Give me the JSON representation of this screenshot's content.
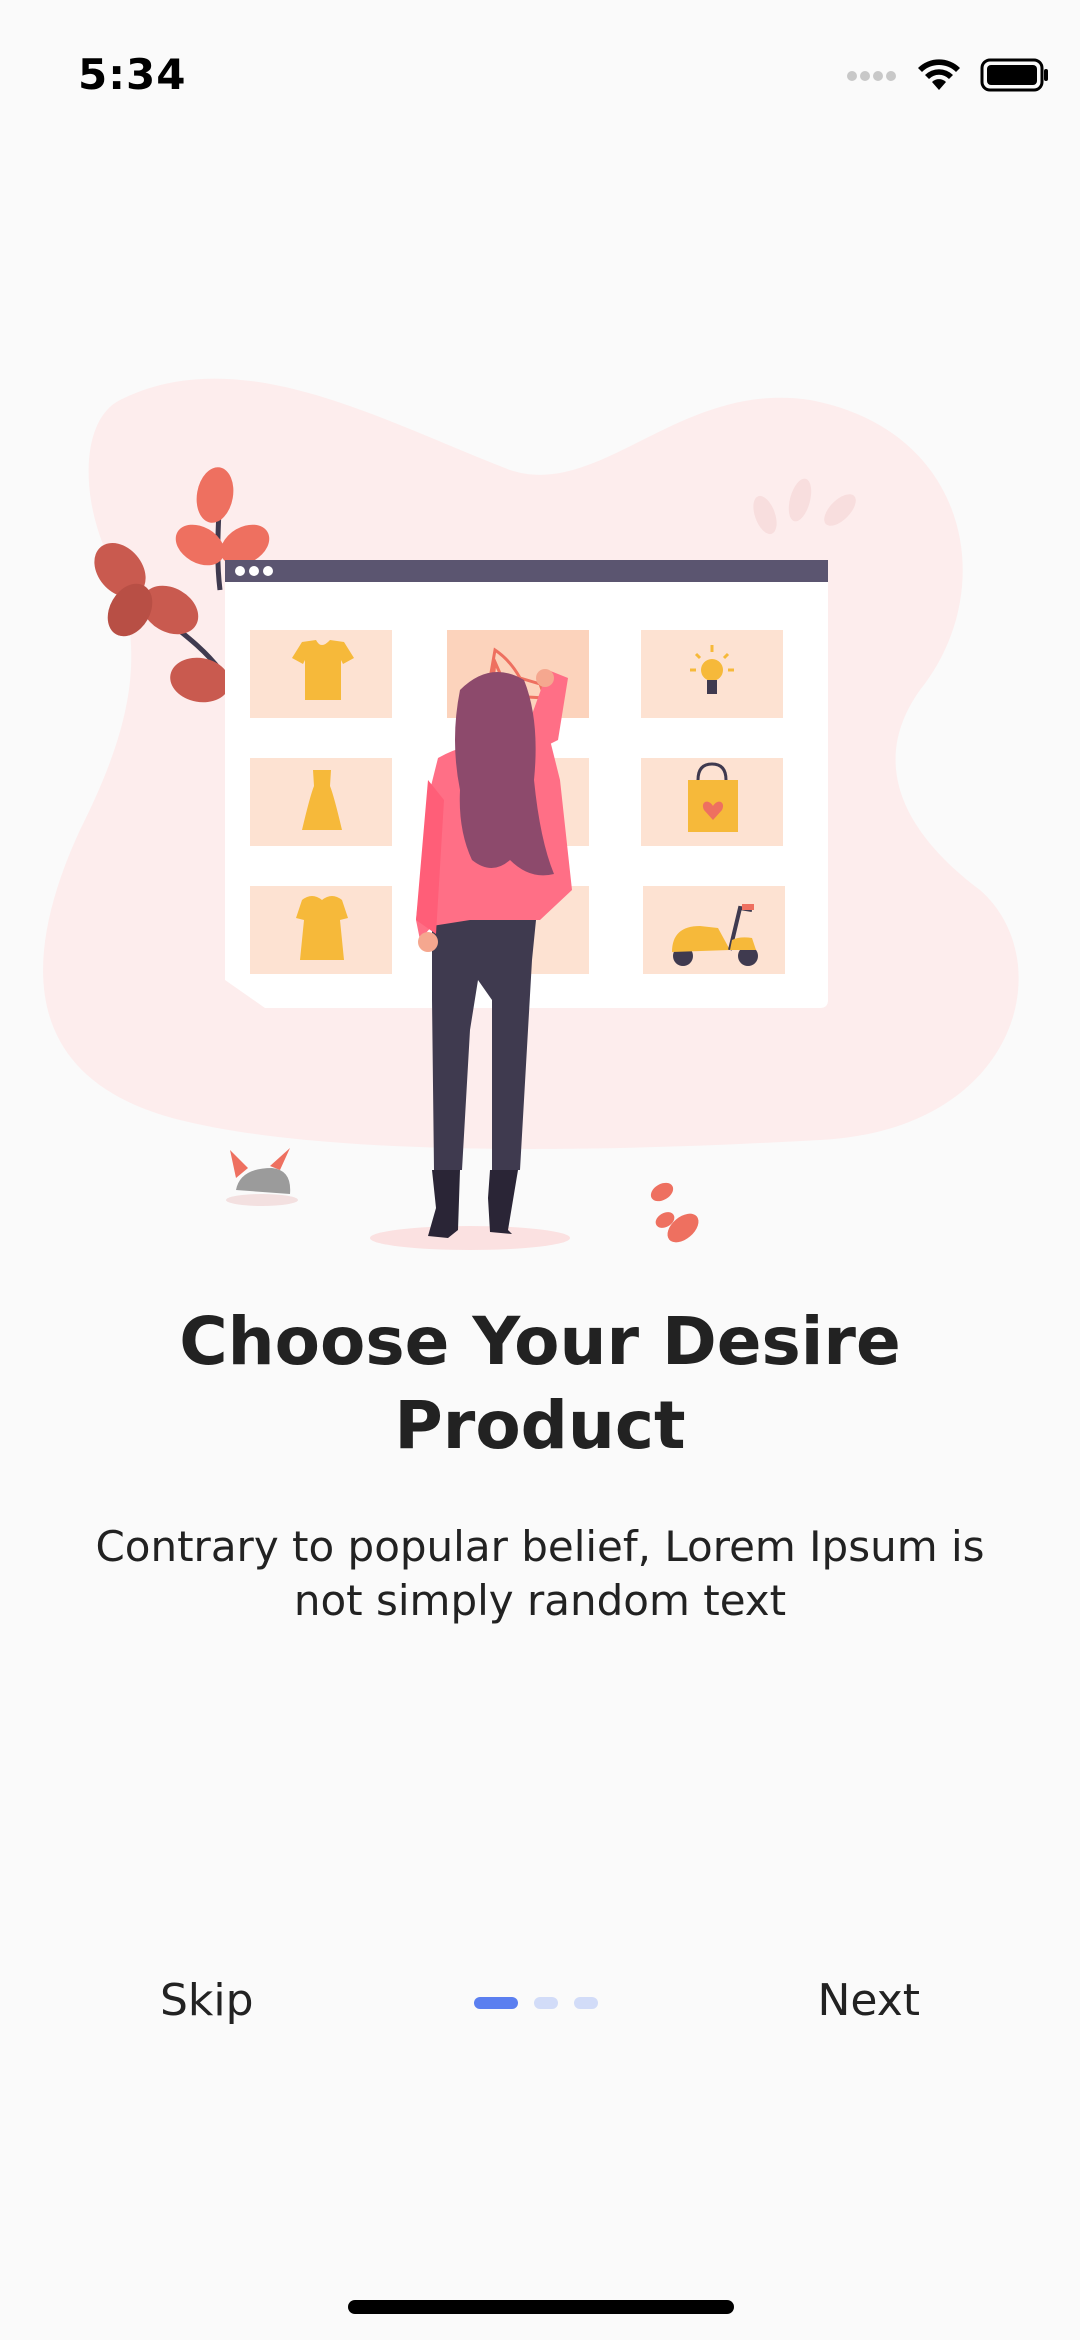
{
  "status_bar": {
    "time": "5:34"
  },
  "onboarding": {
    "title_line1": "Choose Your Desire",
    "title_line2": "Product",
    "subtitle_line1": "Contrary to popular belief, Lorem Ipsum is",
    "subtitle_line2": "not simply random text"
  },
  "nav": {
    "skip_label": "Skip",
    "next_label": "Next",
    "page_count": 3,
    "current_page": 1
  },
  "colors": {
    "background": "#fafafa",
    "blob": "#fdeded",
    "accent_dot": "#5b7ff0",
    "inactive_dot": "#d2dcf8",
    "item_tile": "#fde2d2",
    "item_icon": "#f6b93a",
    "person_jacket": "#ff6f86",
    "person_hair": "#8d4a6c",
    "person_pants": "#3f3a4f",
    "leaf": "#ee7060"
  },
  "icons": {
    "signal": "cellular-signal-icon",
    "wifi": "wifi-icon",
    "battery": "battery-icon"
  }
}
